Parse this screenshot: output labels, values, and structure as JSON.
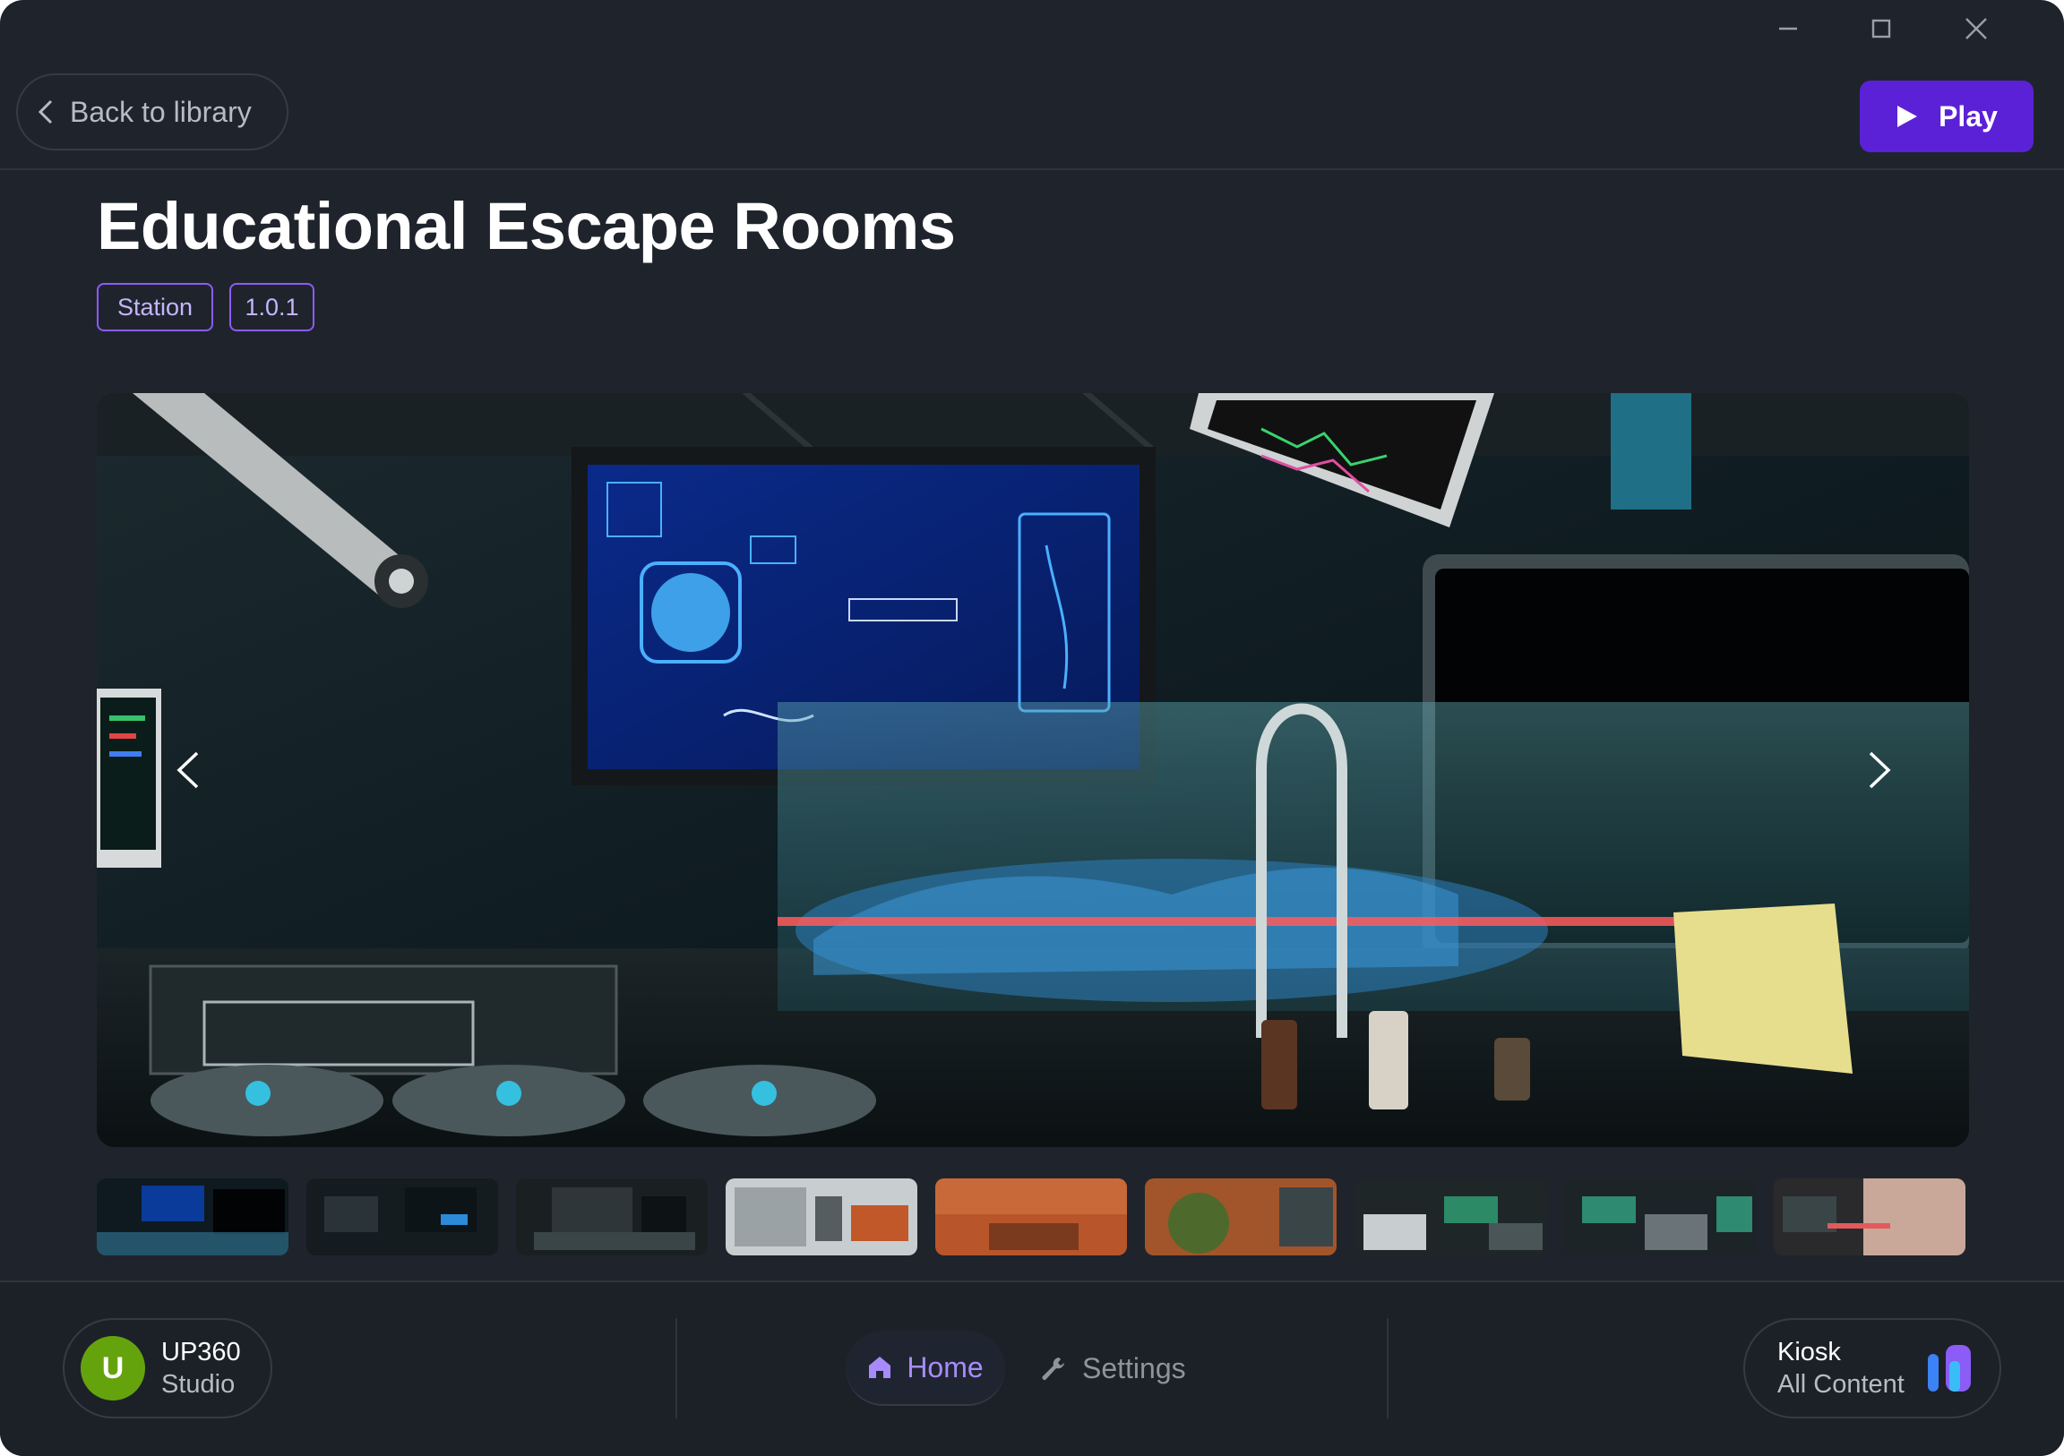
{
  "window": {
    "controls": [
      "minimize-icon",
      "maximize-icon",
      "close-icon"
    ]
  },
  "header": {
    "back_label": "Back to library",
    "play_label": "Play"
  },
  "product": {
    "title": "Educational Escape Rooms",
    "badges": [
      "Station",
      "1.0.1"
    ]
  },
  "gallery": {
    "thumbnail_count": 9,
    "selected_index": 0,
    "prev_icon": "chevron-left-icon",
    "next_icon": "chevron-right-icon"
  },
  "footer": {
    "user": {
      "initial": "U",
      "name": "UP360",
      "role": "Studio"
    },
    "nav": {
      "home_label": "Home",
      "settings_label": "Settings",
      "active": "Home"
    },
    "kiosk": {
      "name": "Kiosk",
      "mode": "All Content"
    }
  },
  "colors": {
    "background": "#1f242c",
    "accent": "#5b21d6",
    "accent_light": "#a78bfa",
    "avatar": "#65a30d"
  }
}
